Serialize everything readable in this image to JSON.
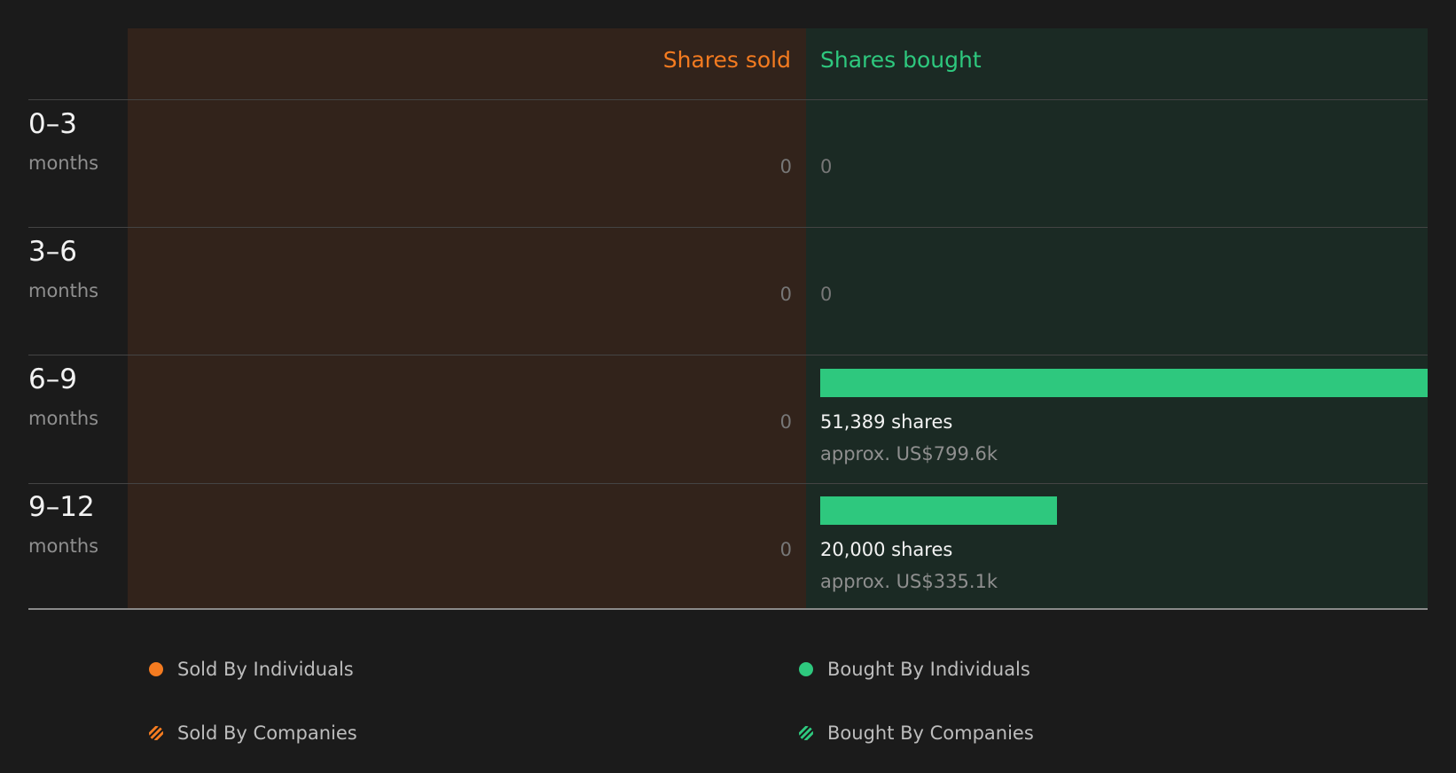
{
  "chart_data": {
    "type": "bar",
    "headers": {
      "sold": "Shares sold",
      "bought": "Shares bought"
    },
    "categories": [
      {
        "range": "0–3",
        "unit": "months"
      },
      {
        "range": "3–6",
        "unit": "months"
      },
      {
        "range": "6–9",
        "unit": "months"
      },
      {
        "range": "9–12",
        "unit": "months"
      }
    ],
    "series": [
      {
        "name": "Shares sold",
        "values": [
          0,
          0,
          0,
          0
        ]
      },
      {
        "name": "Shares bought",
        "values": [
          0,
          0,
          51389,
          20000
        ]
      }
    ],
    "labels": {
      "sold_zero": [
        "0",
        "0",
        "0",
        "0"
      ],
      "bought_zero": [
        "0",
        "0"
      ],
      "bought_shares": [
        "51,389 shares",
        "20,000 shares"
      ],
      "bought_value": [
        "approx. US$799.6k",
        "approx. US$335.1k"
      ]
    },
    "bought_max": 51389,
    "legend": [
      {
        "label": "Sold By Individuals",
        "color": "#f47b20",
        "style": "solid"
      },
      {
        "label": "Bought By Individuals",
        "color": "#2ec87e",
        "style": "solid"
      },
      {
        "label": "Sold By Companies",
        "color": "#f47b20",
        "style": "hatched"
      },
      {
        "label": "Bought By Companies",
        "color": "#2ec87e",
        "style": "hatched"
      }
    ],
    "colors": {
      "sold": "#f47b20",
      "bought": "#2ec87e"
    }
  }
}
